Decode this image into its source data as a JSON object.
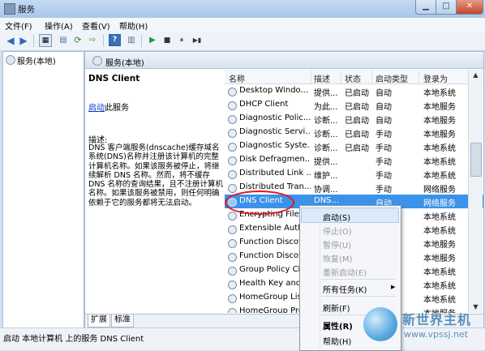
{
  "window": {
    "title": "服务",
    "min_glyph": "▁",
    "max_glyph": "□",
    "close_glyph": "✕"
  },
  "menu": [
    "文件(F)",
    "操作(A)",
    "查看(V)",
    "帮助(H)"
  ],
  "toolbar": {
    "play": "▶",
    "stop": "■",
    "pause": "⏸",
    "restart": "▶▮"
  },
  "left_pane": {
    "tree_item": "服务(本地)"
  },
  "right_pane": {
    "header": "服务(本地)",
    "service_name": "DNS Client",
    "start_link": "启动",
    "start_suffix": "此服务",
    "desc_label": "描述:",
    "description": "DNS 客户端服务(dnscache)缓存域名系统(DNS)名称并注册该计算机的完整计算机名称。如果该服务被停止，将继续解析 DNS 名称。然而，将不缓存 DNS 名称的查询结果，且不注册计算机名称。如果该服务被禁用，则任何明确依赖于它的服务都将无法启动。"
  },
  "columns": [
    "名称",
    "描述",
    "状态",
    "启动类型",
    "登录为"
  ],
  "services": [
    {
      "name": "Desktop Windo...",
      "desc": "提供...",
      "status": "已启动",
      "startup": "自动",
      "logon": "本地系统"
    },
    {
      "name": "DHCP Client",
      "desc": "为此...",
      "status": "已启动",
      "startup": "自动",
      "logon": "本地服务"
    },
    {
      "name": "Diagnostic Polic...",
      "desc": "诊断...",
      "status": "已启动",
      "startup": "自动",
      "logon": "本地服务"
    },
    {
      "name": "Diagnostic Servi...",
      "desc": "诊断...",
      "status": "已启动",
      "startup": "手动",
      "logon": "本地服务"
    },
    {
      "name": "Diagnostic Syste...",
      "desc": "诊断...",
      "status": "已启动",
      "startup": "手动",
      "logon": "本地系统"
    },
    {
      "name": "Disk Defragmen...",
      "desc": "提供...",
      "status": "",
      "startup": "手动",
      "logon": "本地系统"
    },
    {
      "name": "Distributed Link ...",
      "desc": "维护...",
      "status": "",
      "startup": "手动",
      "logon": "本地系统"
    },
    {
      "name": "Distributed Tran...",
      "desc": "协调...",
      "status": "",
      "startup": "手动",
      "logon": "网络服务"
    },
    {
      "name": "DNS Client",
      "desc": "DNS...",
      "status": "",
      "startup": "自动",
      "logon": "网络服务"
    },
    {
      "name": "Encrypting File S...",
      "desc": "",
      "status": "",
      "startup": "",
      "logon": "本地系统"
    },
    {
      "name": "Extensible Authe...",
      "desc": "",
      "status": "",
      "startup": "",
      "logon": "本地系统"
    },
    {
      "name": "Function Discove...",
      "desc": "",
      "status": "",
      "startup": "",
      "logon": "本地服务"
    },
    {
      "name": "Function Discove...",
      "desc": "",
      "status": "",
      "startup": "",
      "logon": "本地服务"
    },
    {
      "name": "Group Policy Cli...",
      "desc": "",
      "status": "",
      "startup": "",
      "logon": "本地系统"
    },
    {
      "name": "Health Key and ...",
      "desc": "",
      "status": "",
      "startup": "",
      "logon": "本地系统"
    },
    {
      "name": "HomeGroup List...",
      "desc": "",
      "status": "",
      "startup": "",
      "logon": "本地系统"
    },
    {
      "name": "HomeGroup Prov...",
      "desc": "",
      "status": "",
      "startup": "",
      "logon": "本地服务"
    }
  ],
  "context_menu": [
    {
      "label": "启动(S)",
      "state": "hot"
    },
    {
      "label": "停止(O)",
      "state": "disabled"
    },
    {
      "label": "暂停(U)",
      "state": "disabled"
    },
    {
      "label": "恢复(M)",
      "state": "disabled"
    },
    {
      "label": "重新启动(E)",
      "state": "disabled"
    },
    {
      "label": "所有任务(K)",
      "state": "normal",
      "submenu": "▶"
    },
    {
      "label": "刷新(F)",
      "state": "normal"
    },
    {
      "label": "属性(R)",
      "state": "bold"
    },
    {
      "label": "帮助(H)",
      "state": "normal"
    }
  ],
  "tabs": [
    "扩展",
    "标准"
  ],
  "status_text": "启动 本地计算机 上的服务 DNS Client",
  "watermark": {
    "title": "新世界主机",
    "url": "www.vpssj.net"
  }
}
